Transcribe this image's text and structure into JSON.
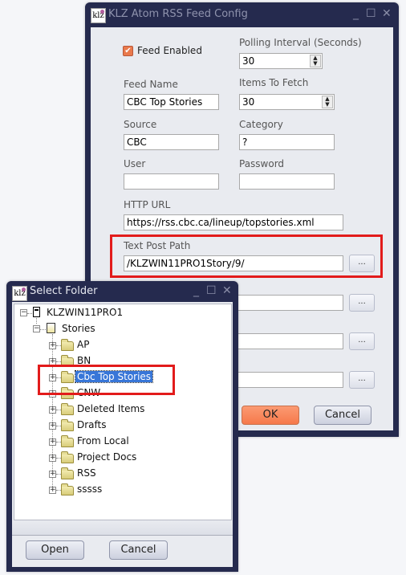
{
  "config_window": {
    "title": "KLZ Atom RSS Feed Config",
    "app_icon_text": "klz",
    "controls": {
      "minimize": "_",
      "maximize": "☐",
      "close": "✕"
    },
    "feed_enabled": {
      "label": "Feed Enabled",
      "checked": true,
      "check_glyph": "✔"
    },
    "polling_interval": {
      "label": "Polling Interval (Seconds)",
      "value": "30"
    },
    "items_to_fetch": {
      "label": "Items To Fetch",
      "value": "30"
    },
    "feed_name": {
      "label": "Feed Name",
      "value": "CBC Top Stories"
    },
    "source": {
      "label": "Source",
      "value": "CBC"
    },
    "category": {
      "label": "Category",
      "value": "?"
    },
    "user": {
      "label": "User",
      "value": ""
    },
    "password": {
      "label": "Password",
      "value": ""
    },
    "http_url": {
      "label": "HTTP URL",
      "value": "https://rss.cbc.ca/lineup/topstories.xml"
    },
    "text_post_path": {
      "label": "Text Post Path",
      "value": "/KLZWIN11PRO1Story/9/"
    },
    "hidden_paths": [
      {
        "value": ""
      },
      {
        "value": ""
      },
      {
        "value": ""
      }
    ],
    "browse_label": "...",
    "spin_up": "▲",
    "spin_down": "▼",
    "ok_label": "OK",
    "cancel_label": "Cancel"
  },
  "folder_dialog": {
    "title": "Select Folder",
    "app_icon_text": "klz",
    "controls": {
      "minimize": "_",
      "maximize": "☐",
      "close": "✕"
    },
    "root": {
      "label": "KLZWIN11PRO1",
      "expander": "⊟"
    },
    "stories": {
      "label": "Stories",
      "expander": "⊟"
    },
    "folders": [
      {
        "label": "AP",
        "selected": false
      },
      {
        "label": "BN",
        "selected": false
      },
      {
        "label": "Cbc Top Stories",
        "selected": true
      },
      {
        "label": "CNW",
        "selected": false
      },
      {
        "label": "Deleted Items",
        "selected": false
      },
      {
        "label": "Drafts",
        "selected": false
      },
      {
        "label": "From Local",
        "selected": false
      },
      {
        "label": "Project Docs",
        "selected": false
      },
      {
        "label": "RSS",
        "selected": false
      },
      {
        "label": "sssss",
        "selected": false
      }
    ],
    "expand_glyph": "+",
    "open_label": "Open",
    "cancel_label": "Cancel"
  },
  "colors": {
    "title_bar": "#252a4e",
    "highlight_box": "#e21b1b",
    "ok_button": "#f6794b",
    "selection": "#3876d8"
  }
}
